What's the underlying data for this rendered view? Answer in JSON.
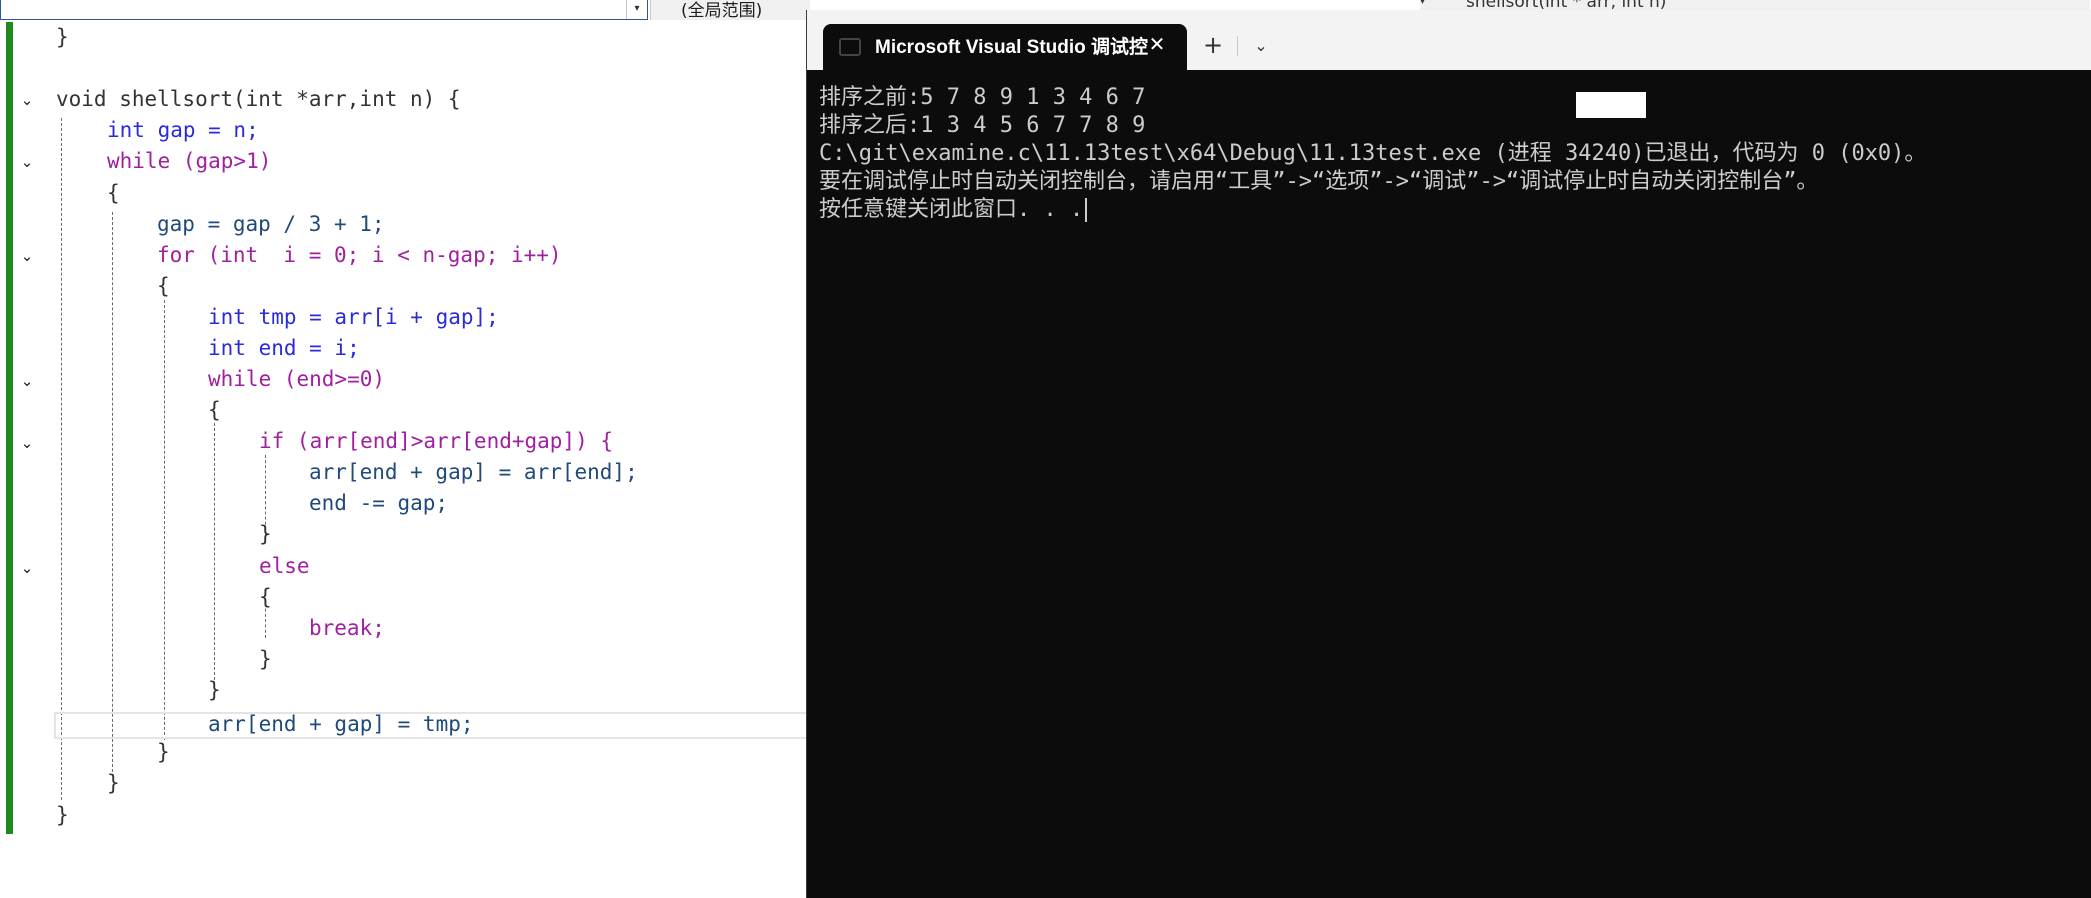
{
  "editor": {
    "scope_dropdown": "(全局范围)",
    "scope_dropdown_arrow": "▾",
    "fold_glyph": "⌄",
    "code_lines": [
      "}",
      "void shellsort(int *arr,int n) {",
      "int gap = n;",
      "while (gap>1)",
      "{",
      "gap = gap / 3 + 1;",
      "for (int  i = 0; i < n-gap; i++)",
      "{",
      "int tmp = arr[i + gap];",
      "int end = i;",
      "while (end>=0)",
      "{",
      "if (arr[end]>arr[end+gap]) {",
      "arr[end + gap] = arr[end];",
      "end -= gap;",
      "}",
      "else",
      "{",
      "break;",
      "}",
      "}",
      "arr[end + gap] = tmp;",
      "}",
      "}",
      "}"
    ]
  },
  "member_dropdown": "shellsort(int * arr, int n)",
  "console": {
    "tab_title": "Microsoft Visual Studio 调试控",
    "close_glyph": "✕",
    "new_tab_glyph": "+",
    "menu_glyph": "⌄",
    "lines": [
      "排序之前:5 7 8 9 1 3 4 6 7",
      "排序之后:1 3 4 5 6 7 7 8 9",
      "C:\\git\\examine.c\\11.13test\\x64\\Debug\\11.13test.exe (进程 34240)已退出，代码为 0 (0x0)。",
      "要在调试停止时自动关闭控制台，请启用“工具”->“选项”->“调试”->“调试停止时自动关闭控制台”。",
      "按任意键关闭此窗口. . ."
    ]
  },
  "colors": {
    "console_bg": "#0c0c0c",
    "console_text": "#cccccc",
    "change_bar": "#1f8a1f",
    "keyword": "#2b2bdb",
    "control": "#a020a0"
  }
}
